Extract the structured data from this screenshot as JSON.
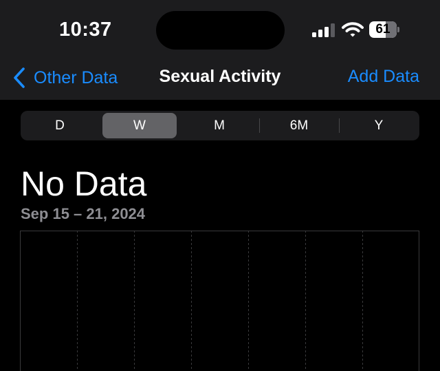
{
  "status_bar": {
    "time": "10:37",
    "battery_level": "61",
    "battery_fraction": 0.61
  },
  "nav": {
    "back_label": "Other Data",
    "title": "Sexual Activity",
    "action_label": "Add Data"
  },
  "segments": [
    {
      "label": "D",
      "selected": false
    },
    {
      "label": "W",
      "selected": true
    },
    {
      "label": "M",
      "selected": false
    },
    {
      "label": "6M",
      "selected": false
    },
    {
      "label": "Y",
      "selected": false
    }
  ],
  "summary": {
    "headline": "No Data",
    "date_range": "Sep 15 – 21, 2024"
  },
  "chart_data": {
    "type": "bar",
    "categories": [],
    "values": [],
    "title": "",
    "xlabel": "",
    "ylabel": "",
    "grid": true,
    "gridline_style": "dashed vertical",
    "columns": 7
  },
  "colors": {
    "accent": "#1a8cff",
    "background": "#000000",
    "bar_background": "#1c1c1e",
    "secondary_text": "#8e8e93",
    "segment_selected": "#636366"
  }
}
